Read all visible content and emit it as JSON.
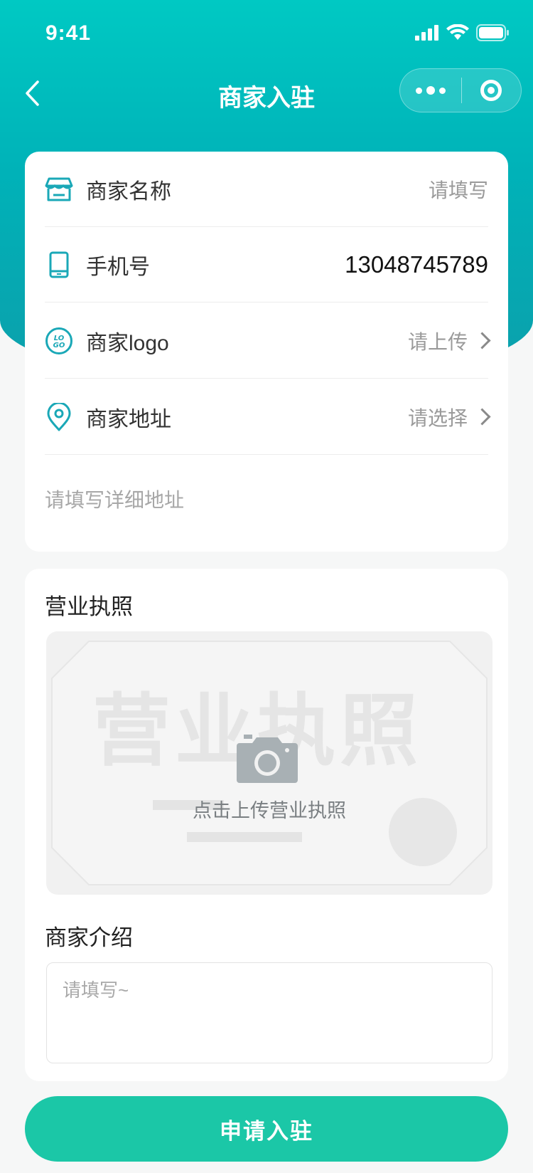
{
  "status_bar": {
    "time": "9:41"
  },
  "nav": {
    "title": "商家入驻"
  },
  "form": {
    "name_label": "商家名称",
    "name_placeholder": "请填写",
    "phone_label": "手机号",
    "phone_value": "13048745789",
    "logo_label": "商家logo",
    "logo_action": "请上传",
    "address_label": "商家地址",
    "address_action": "请选择",
    "detail_address_placeholder": "请填写详细地址"
  },
  "license": {
    "title": "营业执照",
    "watermark": "营业执照",
    "upload_text": "点击上传营业执照"
  },
  "intro": {
    "title": "商家介绍",
    "placeholder": "请填写~"
  },
  "submit_label": "申请入驻",
  "colors": {
    "hero": "#00c0be",
    "accent": "#1bc7a7",
    "icon": "#1aa8b7"
  },
  "icons": [
    "chevron-left-icon",
    "more-icon",
    "close-target-icon",
    "store-icon",
    "phone-icon",
    "logo-icon",
    "location-pin-icon",
    "chevron-right-icon",
    "camera-icon"
  ]
}
